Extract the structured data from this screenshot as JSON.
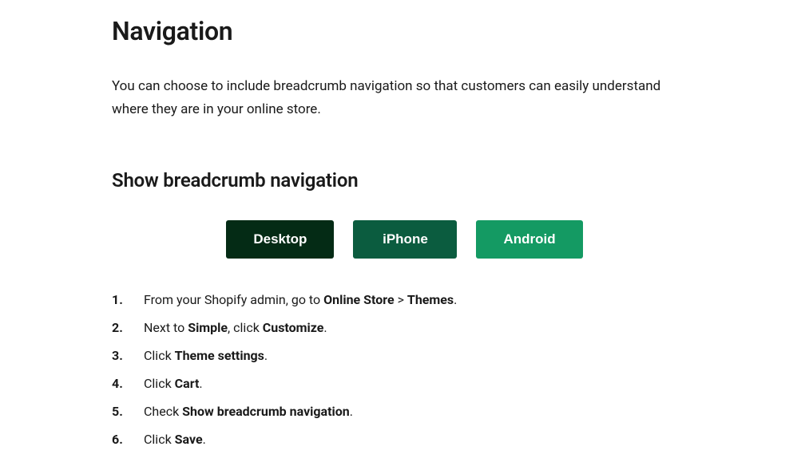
{
  "page": {
    "title": "Navigation",
    "intro": "You can choose to include breadcrumb navigation so that customers can easily understand where they are in your online store."
  },
  "section": {
    "title": "Show breadcrumb navigation"
  },
  "tabs": {
    "desktop": "Desktop",
    "iphone": "iPhone",
    "android": "Android"
  },
  "steps": [
    {
      "number": "1",
      "parts": [
        {
          "text": "From your Shopify admin, go to ",
          "bold": false
        },
        {
          "text": "Online Store",
          "bold": true
        },
        {
          "text": " > ",
          "bold": false
        },
        {
          "text": "Themes",
          "bold": true
        },
        {
          "text": ".",
          "bold": false
        }
      ]
    },
    {
      "number": "2",
      "parts": [
        {
          "text": "Next to ",
          "bold": false
        },
        {
          "text": "Simple",
          "bold": true
        },
        {
          "text": ", click ",
          "bold": false
        },
        {
          "text": "Customize",
          "bold": true
        },
        {
          "text": ".",
          "bold": false
        }
      ]
    },
    {
      "number": "3",
      "parts": [
        {
          "text": "Click ",
          "bold": false
        },
        {
          "text": "Theme settings",
          "bold": true
        },
        {
          "text": ".",
          "bold": false
        }
      ]
    },
    {
      "number": "4",
      "parts": [
        {
          "text": "Click ",
          "bold": false
        },
        {
          "text": "Cart",
          "bold": true
        },
        {
          "text": ".",
          "bold": false
        }
      ]
    },
    {
      "number": "5",
      "parts": [
        {
          "text": "Check ",
          "bold": false
        },
        {
          "text": "Show breadcrumb navigation",
          "bold": true
        },
        {
          "text": ".",
          "bold": false
        }
      ]
    },
    {
      "number": "6",
      "parts": [
        {
          "text": "Click ",
          "bold": false
        },
        {
          "text": "Save",
          "bold": true
        },
        {
          "text": ".",
          "bold": false
        }
      ]
    }
  ]
}
